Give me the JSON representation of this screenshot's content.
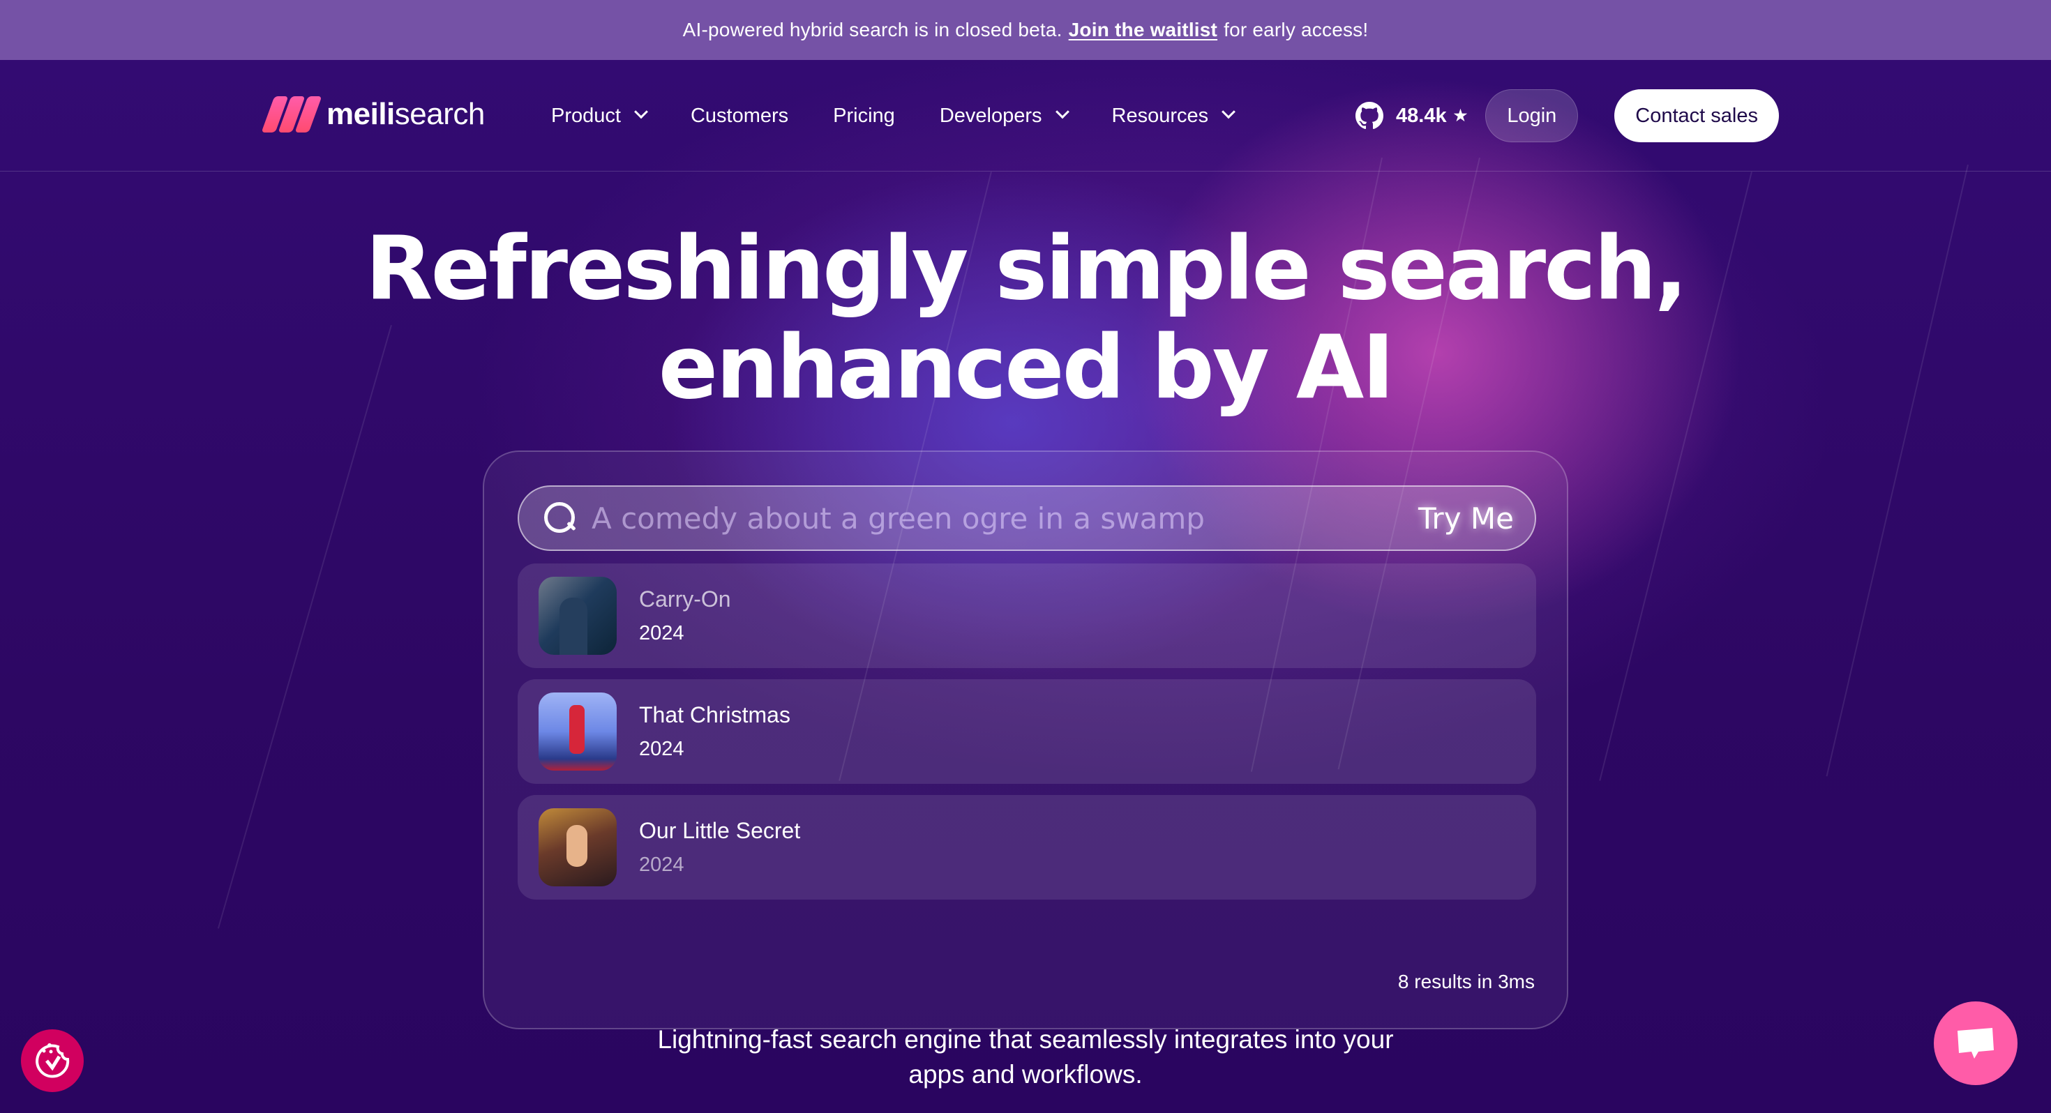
{
  "banner": {
    "text_before": "AI-powered hybrid search is in closed beta.",
    "link": "Join the waitlist",
    "text_after": "for early access!"
  },
  "nav": {
    "logo_bold": "meili",
    "logo_light": "search",
    "links": [
      {
        "label": "Product",
        "dropdown": true
      },
      {
        "label": "Customers",
        "dropdown": false
      },
      {
        "label": "Pricing",
        "dropdown": false
      },
      {
        "label": "Developers",
        "dropdown": true
      },
      {
        "label": "Resources",
        "dropdown": true
      }
    ],
    "github_stars": "48.4k",
    "star_glyph": "★",
    "login": "Login",
    "contact": "Contact sales"
  },
  "hero": {
    "title_line1": "Refreshingly simple search,",
    "title_line2": "enhanced by AI",
    "subtitle_line1": "Lightning-fast search engine that seamlessly integrates into your",
    "subtitle_line2": "apps and workflows."
  },
  "demo": {
    "search_placeholder": "A comedy about a green ogre in a swamp",
    "try_me": "Try Me",
    "results": [
      {
        "title": "Carry-On",
        "year": "2024"
      },
      {
        "title": "That Christmas",
        "year": "2024"
      },
      {
        "title": "Our Little Secret",
        "year": "2024"
      }
    ],
    "count_text": "8 results in 3ms"
  },
  "colors": {
    "background": "#2a0660",
    "banner": "#7552a6",
    "brand_pink": "#ff5ca8",
    "cookie_badge": "#d1005f"
  },
  "icons": {
    "logo": "meilisearch-logo-icon",
    "github": "github-icon",
    "search": "search-icon",
    "cookie": "cookie-consent-icon",
    "chat": "chat-bubble-icon"
  }
}
